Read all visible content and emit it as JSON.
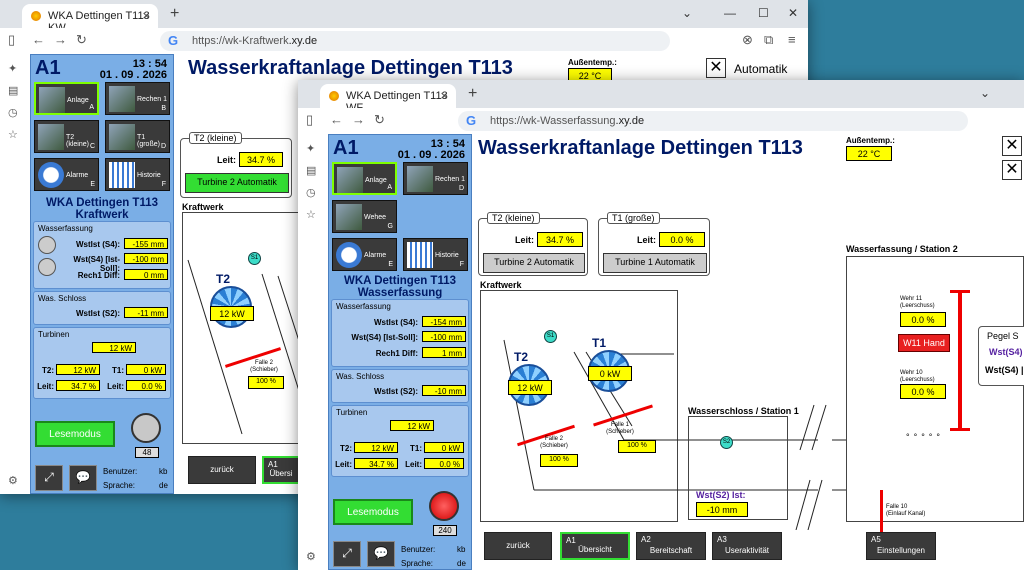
{
  "back": {
    "tab_title": "WKA Dettingen T113 KW",
    "url_host": "https://wk-Kraftwerk",
    "url_rest": ".xy.de",
    "a1": "A1",
    "time": "13 : 54",
    "date": "01 . 09 . 2026",
    "title": "Wasserkraftanlage Dettingen T113",
    "buttons": [
      {
        "label": "Anlage",
        "letter": "A"
      },
      {
        "label": "Rechen 1",
        "letter": "B"
      },
      {
        "label": "T2 (kleine)",
        "letter": "C"
      },
      {
        "label": "T1 (große)",
        "letter": "D"
      },
      {
        "label": "Alarme",
        "letter": "E"
      },
      {
        "label": "Historie",
        "letter": "F"
      }
    ],
    "station_line1": "WKA Dettingen T113",
    "station_line2": "Kraftwerk",
    "wasserfassung": "Wasserfassung",
    "wstist_s4_label": "WstIst (S4):",
    "wstist_s4": "-155 mm",
    "wst_s4_diff_label": "Wst(S4) [Ist-Soll]:",
    "wst_s4_diff": "-100 mm",
    "rech1_label": "Rech1 Diff:",
    "rech1": "0 mm",
    "schloss": "Was. Schloss",
    "wstist_s2_label": "WstIst (S2):",
    "wstist_s2": "-11 mm",
    "turbinen": "Turbinen",
    "total": "12 kW",
    "t2_label": "T2:",
    "t2": "12 kW",
    "t1_label": "T1:",
    "t1": "0 kW",
    "leit_label": "Leit:",
    "leit_t2": "34.7 %",
    "leit_t1": "0.0 %",
    "lesemodus": "Lesemodus",
    "gauge": "48",
    "benutzer_label": "Benutzer:",
    "benutzer": "kb",
    "sprache_label": "Sprache:",
    "sprache": "de",
    "aussentemp_label": "Außentemp.:",
    "aussentemp": "22 °C",
    "automatik": "Automatik",
    "t2_box_title": "T2 (kleine)",
    "t2_box_leit": "34.7 %",
    "t2_box_btn": "Turbine 2 Automatik",
    "kraftwerk": "Kraftwerk",
    "t2_name": "T2",
    "t2_kw": "12 kW",
    "s1": "S1",
    "falle2": "Falle 2",
    "schieber": "(Schieber)",
    "falle2_val": "100 %",
    "zurueck": "zurück",
    "a1_btn": "A1",
    "a1_btn_text": "Übersi"
  },
  "front": {
    "tab_title": "WKA Dettingen T113 WF",
    "url_host": "https://wk-Wasserfassung",
    "url_rest": ".xy.de",
    "a1": "A1",
    "time": "13 : 54",
    "date": "01 . 09 . 2026",
    "title": "Wasserkraftanlage Dettingen T113",
    "buttons": [
      {
        "label": "Anlage",
        "letter": "A"
      },
      {
        "label": "Rechen 1",
        "letter": "D"
      },
      {
        "label": "Wehee",
        "letter": "G"
      },
      {
        "label": "Alarme",
        "letter": "E"
      },
      {
        "label": "Historie",
        "letter": "F"
      }
    ],
    "station_line1": "WKA Dettingen T113",
    "station_line2": "Wasserfassung",
    "wasserfassung": "Wasserfassung",
    "wstist_s4_label": "WstIst (S4):",
    "wstist_s4": "-154 mm",
    "wst_s4_diff_label": "Wst(S4) [Ist-Soll]:",
    "wst_s4_diff": "-100 mm",
    "rech1_label": "Rech1 Diff:",
    "rech1": "1 mm",
    "schloss": "Was. Schloss",
    "wstist_s2_label": "WstIst (S2):",
    "wstist_s2": "-10 mm",
    "turbinen": "Turbinen",
    "total": "12 kW",
    "t2_label": "T2:",
    "t2": "12 kW",
    "t1_label": "T1:",
    "t1": "0 kW",
    "leit_label": "Leit:",
    "leit_t2": "34.7 %",
    "leit_t1": "0.0 %",
    "lesemodus": "Lesemodus",
    "gauge": "240",
    "benutzer_label": "Benutzer:",
    "benutzer": "kb",
    "sprache_label": "Sprache:",
    "sprache": "de",
    "aussentemp_label": "Außentemp.:",
    "aussentemp": "22 °C",
    "t2_box_title": "T2 (kleine)",
    "t2_box_leit": "34.7 %",
    "t2_box_btn": "Turbine 2 Automatik",
    "t1_box_title": "T1 (große)",
    "t1_box_leit": "0.0 %",
    "t1_box_btn": "Turbine 1 Automatik",
    "kraftwerk": "Kraftwerk",
    "t2_name": "T2",
    "t1_name": "T1",
    "t2_kw": "12 kW",
    "t1_kw": "0 kW",
    "s1": "S1",
    "s2": "S2",
    "falle2": "Falle 2",
    "falle1": "Falle 1",
    "schieber": "(Schieber)",
    "falle2_val": "100 %",
    "falle1_val": "100 %",
    "wasserschloss": "Wasserschloss / Station 1",
    "wst_s2_ist_label": "Wst(S2) Ist:",
    "wst_s2_ist": "-10 mm",
    "wasserfassung_station": "Wasserfassung / Station 2",
    "wehr11": "Wehr 11",
    "wehr10": "Wehr 10",
    "leerschuss": "(Leerschuss)",
    "wehr11_val": "0.0 %",
    "wehr10_val": "0.0 %",
    "w11_hand": "W11 Hand",
    "falle10": "Falle 10",
    "einlauf": "(Einlauf Kanal)",
    "pegel": "Pegel S",
    "wst_s_short": "Wst(S4)",
    "wst_s_short2": "Wst(S4) |",
    "nav": [
      {
        "code": "",
        "label": "zurück"
      },
      {
        "code": "A1",
        "label": "Übersicht"
      },
      {
        "code": "A2",
        "label": "Bereitschaft"
      },
      {
        "code": "A3",
        "label": "Useraktivität"
      },
      {
        "code": "A5",
        "label": "Einstellungen"
      }
    ]
  }
}
